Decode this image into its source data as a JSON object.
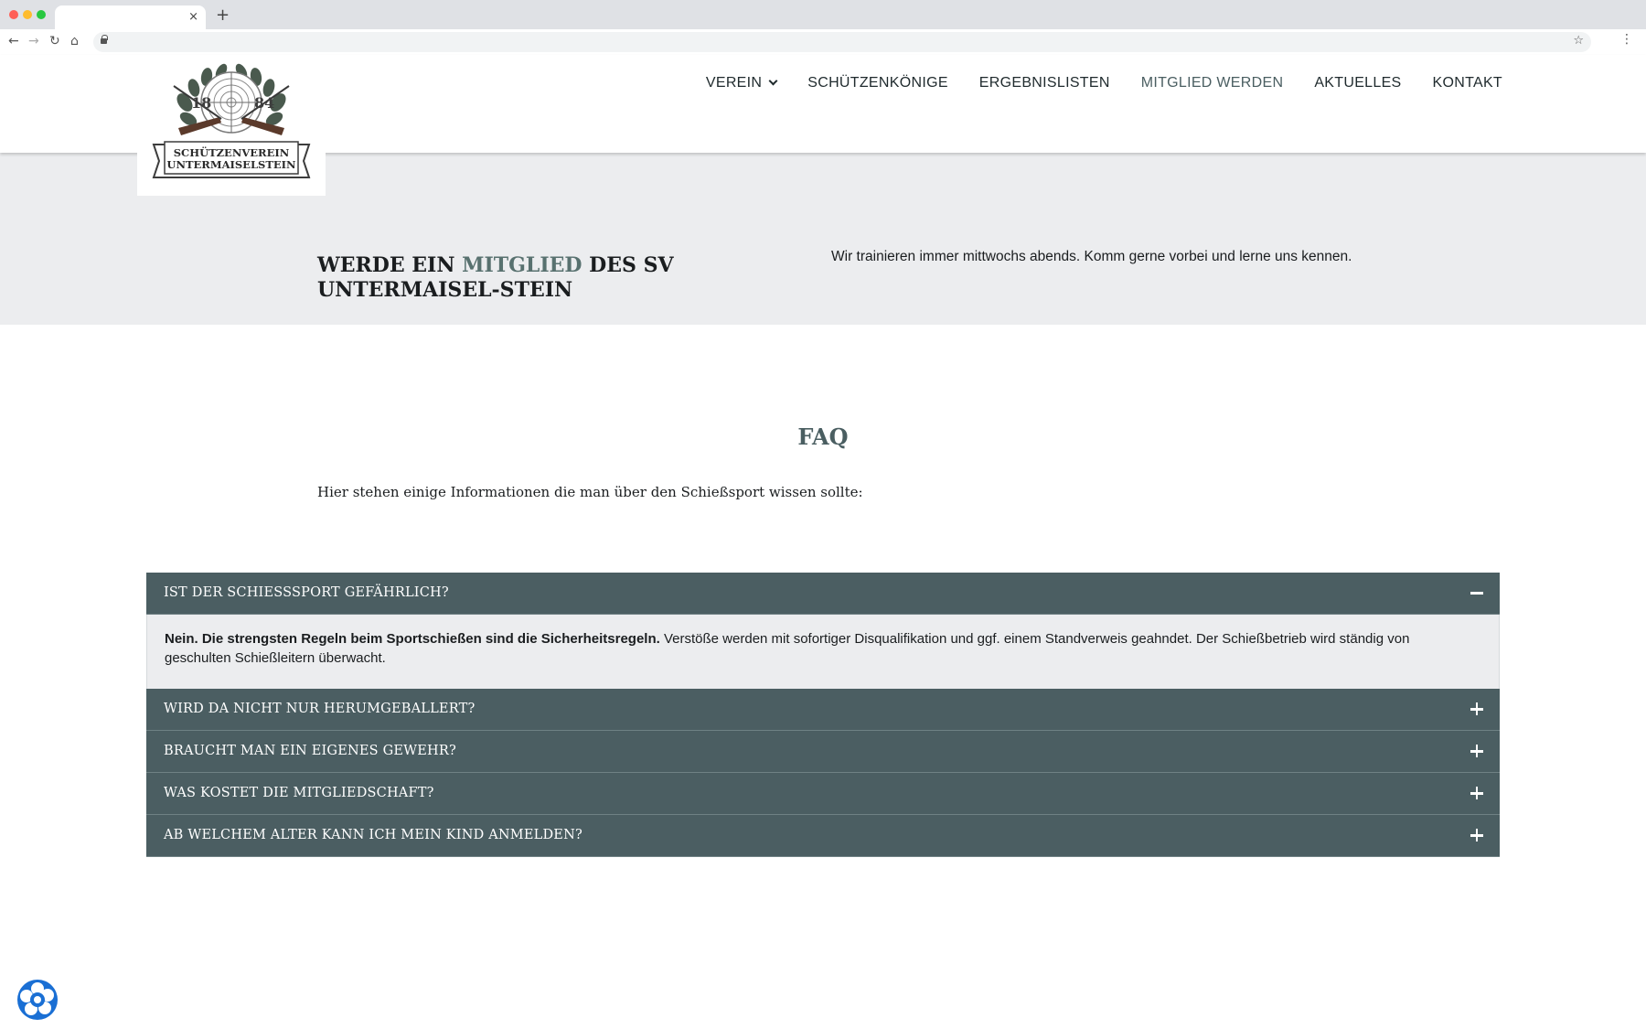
{
  "browser": {
    "tab_close": "×",
    "new_tab": "+",
    "back": "←",
    "forward": "→",
    "reload": "↻",
    "home": "⌂",
    "bookmark": "☆",
    "menu": "⋮"
  },
  "logo": {
    "year_left": "18",
    "year_right": "84",
    "line1": "SCHÜTZENVEREIN",
    "line2": "UNTERMAISELSTEIN"
  },
  "nav": {
    "items": [
      {
        "label": "VEREIN",
        "has_dropdown": true
      },
      {
        "label": "SCHÜTZENKÖNIGE"
      },
      {
        "label": "ERGEBNISLISTEN"
      },
      {
        "label": "MITGLIED WERDEN",
        "active": true
      },
      {
        "label": "AKTUELLES"
      },
      {
        "label": "KONTAKT"
      }
    ]
  },
  "hero": {
    "title_part1": "Werde ein ",
    "title_accent": "Mitglied",
    "title_part2": " des SV Untermaisel-stein",
    "text": "Wir trainieren immer mittwochs abends. Komm gerne vorbei und lerne uns kennen."
  },
  "faq": {
    "heading": "FAQ",
    "intro": "Hier stehen einige Informationen die man über den Schießsport wissen sollte:",
    "items": [
      {
        "question": "Ist der Schießsport gefährlich?",
        "expanded": true,
        "answer_bold": "Nein. Die strengsten Regeln beim Sportschießen sind die Sicherheitsregeln.",
        "answer_rest": " Verstöße werden mit sofortiger Disqualifikation und ggf. einem Standverweis geahndet. Der Schießbetrieb wird ständig von geschulten Schießleitern überwacht."
      },
      {
        "question": "Wird da nicht nur herumgeballert?",
        "expanded": false
      },
      {
        "question": "Braucht man ein eigenes Gewehr?",
        "expanded": false
      },
      {
        "question": "Was kostet die Mitgliedschaft?",
        "expanded": false
      },
      {
        "question": "Ab welchem Alter kann ich mein Kind anmelden?",
        "expanded": false
      }
    ]
  },
  "colors": {
    "accent": "#58716f",
    "accordion_bg": "#4b5e62",
    "hero_bg": "#ecedef",
    "nav_active": "#4a5e61"
  }
}
